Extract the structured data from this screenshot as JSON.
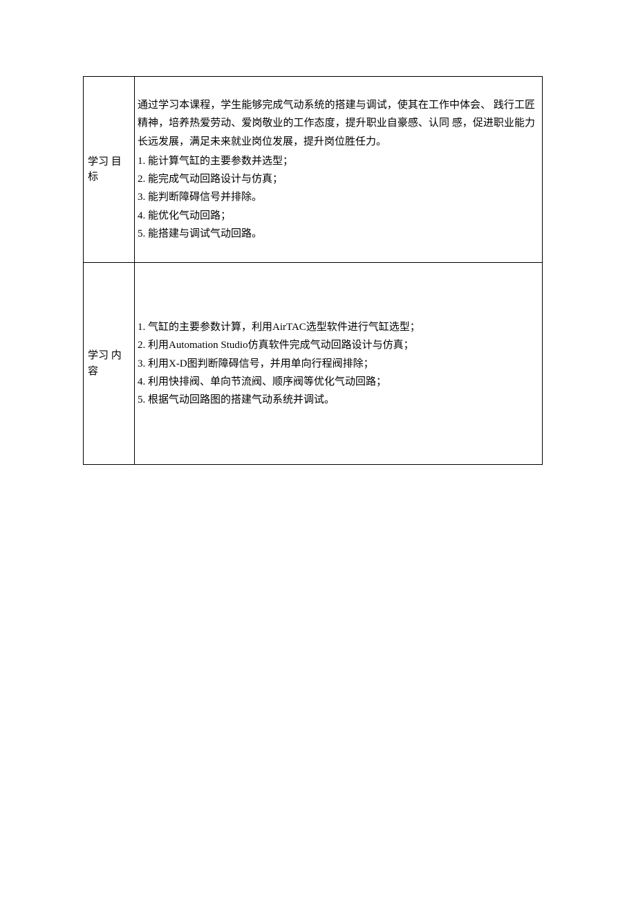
{
  "table": {
    "rows": [
      {
        "label": "学习 目标",
        "intro": "通过学习本课程，学生能够完成气动系统的搭建与调试，使其在工作中体会、 践行工匠精神，培养热爱劳动、爱岗敬业的工作态度，提升职业自豪感、认同 感，促进职业能力长远发展，满足未来就业岗位发展，提升岗位胜任力。",
        "items": [
          "1. 能计算气缸的主要参数并选型；",
          "2. 能完成气动回路设计与仿真；",
          "3. 能判断障碍信号并排除。",
          "4. 能优化气动回路；",
          "5. 能搭建与调试气动回路。"
        ]
      },
      {
        "label": "学习 内容",
        "intro": "",
        "items": [
          "1. 气缸的主要参数计算，利用AirTAC选型软件进行气缸选型；",
          "2. 利用Automation Studio仿真软件完成气动回路设计与仿真；",
          "3. 利用X-D图判断障碍信号，并用单向行程阀排除；",
          "4. 利用快排阀、单向节流阀、顺序阀等优化气动回路；",
          "5. 根据气动回路图的搭建气动系统并调试。"
        ]
      }
    ]
  }
}
